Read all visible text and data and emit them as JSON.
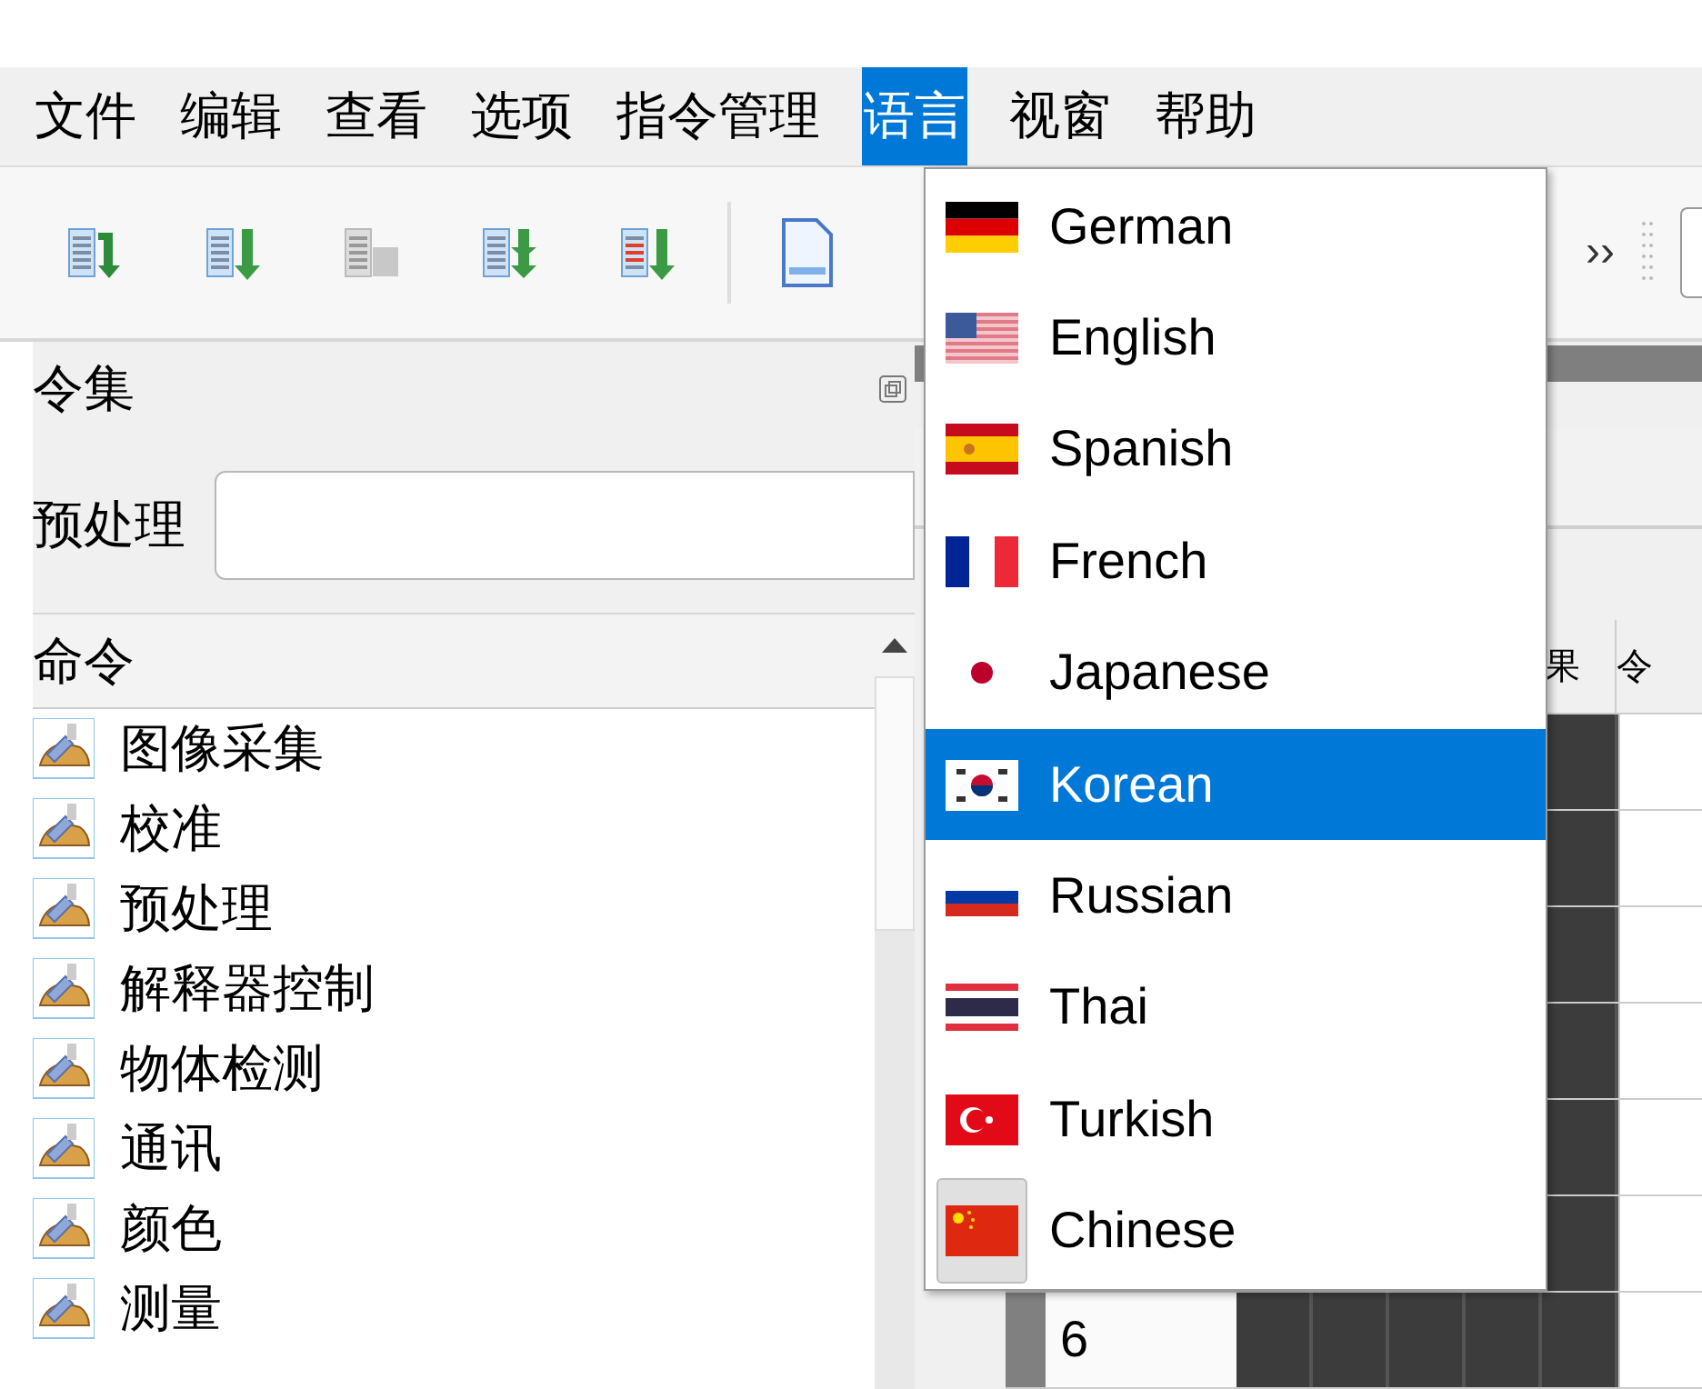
{
  "menu_bar": [
    {
      "label": "文件",
      "selected": false
    },
    {
      "label": "编辑",
      "selected": false
    },
    {
      "label": "查看",
      "selected": false
    },
    {
      "label": "选项",
      "selected": false
    },
    {
      "label": "指令管理",
      "selected": false
    },
    {
      "label": "语言",
      "selected": true
    },
    {
      "label": "视窗",
      "selected": false
    },
    {
      "label": "帮助",
      "selected": false
    }
  ],
  "toolbar": {
    "overflow": "››"
  },
  "dock": {
    "title": "令集",
    "filter_label": "预处理",
    "list_header": "命令",
    "items": [
      "图像采集",
      "校准",
      "预处理",
      "解释器控制",
      "物体检测",
      "通讯",
      "颜色",
      "测量"
    ]
  },
  "table": {
    "column_headers": [
      "果",
      "令"
    ],
    "row_label": "6"
  },
  "language_menu": [
    {
      "label": "German",
      "kind": "de",
      "selected": false,
      "checked": false
    },
    {
      "label": "English",
      "kind": "us",
      "selected": false,
      "checked": false
    },
    {
      "label": "Spanish",
      "kind": "es",
      "selected": false,
      "checked": false
    },
    {
      "label": "French",
      "kind": "fr",
      "selected": false,
      "checked": false
    },
    {
      "label": "Japanese",
      "kind": "jp",
      "selected": false,
      "checked": false
    },
    {
      "label": "Korean",
      "kind": "kr",
      "selected": true,
      "checked": false
    },
    {
      "label": "Russian",
      "kind": "ru",
      "selected": false,
      "checked": false
    },
    {
      "label": "Thai",
      "kind": "th",
      "selected": false,
      "checked": false
    },
    {
      "label": "Turkish",
      "kind": "tr",
      "selected": false,
      "checked": false
    },
    {
      "label": "Chinese",
      "kind": "cn",
      "selected": false,
      "checked": true
    }
  ]
}
